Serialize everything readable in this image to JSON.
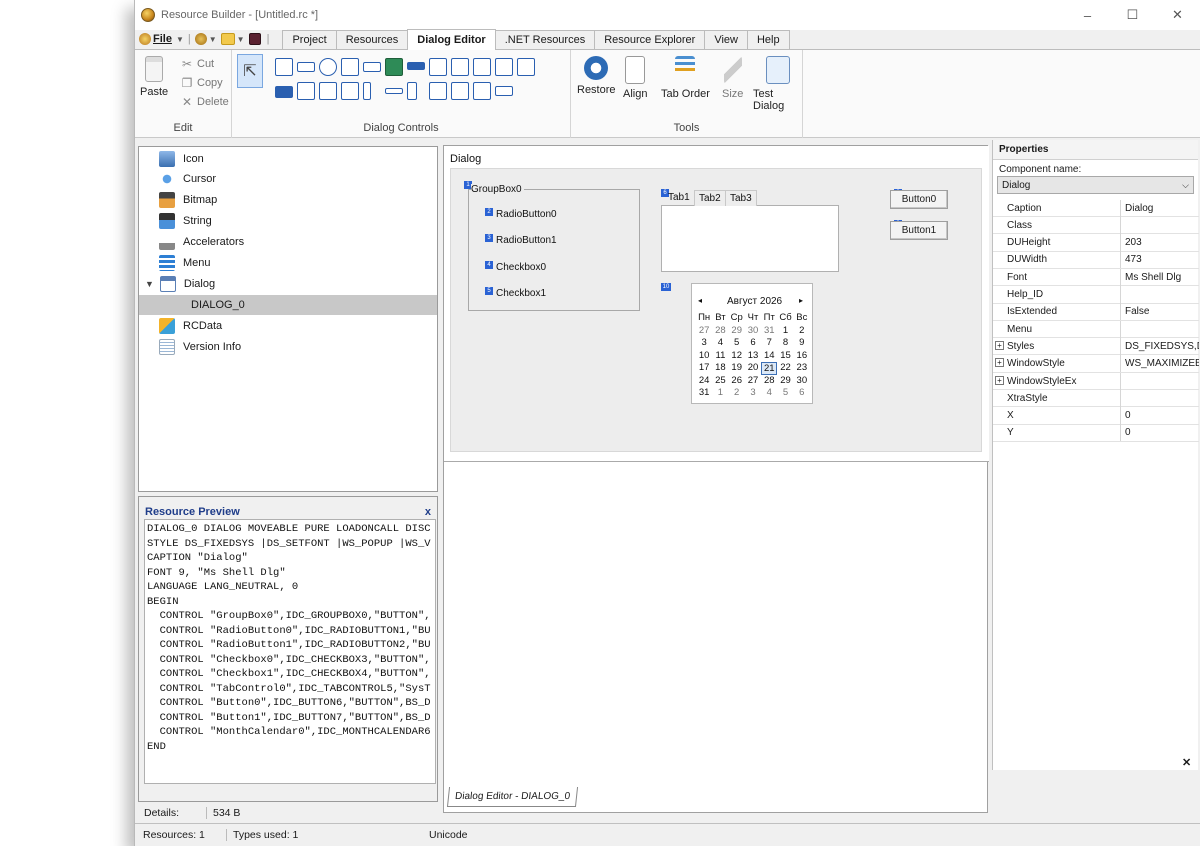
{
  "window": {
    "title": "Resource Builder - [Untitled.rc *]",
    "minimize": "–",
    "maximize": "☐",
    "close": "✕"
  },
  "quick_access": {
    "file_label": "File"
  },
  "menu_tabs": [
    "Project",
    "Resources",
    "Dialog Editor",
    ".NET Resources",
    "Resource Explorer",
    "View",
    "Help"
  ],
  "active_menu_tab": "Dialog Editor",
  "ribbon": {
    "edit_group": {
      "paste": "Paste",
      "cut": "Cut",
      "copy": "Copy",
      "delete": "Delete",
      "label": "Edit"
    },
    "controls_group": {
      "label": "Dialog Controls"
    },
    "tools_group": {
      "restore": "Restore",
      "align": "Align",
      "tab_order": "Tab Order",
      "size": "Size",
      "test_dialog": "Test Dialog",
      "label": "Tools"
    }
  },
  "tree": {
    "items": [
      "Icon",
      "Cursor",
      "Bitmap",
      "String",
      "Accelerators",
      "Menu",
      "Dialog",
      "DIALOG_0",
      "RCData",
      "Version Info"
    ],
    "selected": "DIALOG_0"
  },
  "preview": {
    "title": "Resource Preview",
    "close": "x",
    "lines": [
      "DIALOG_0 DIALOG MOVEABLE PURE LOADONCALL DISC",
      "STYLE DS_FIXEDSYS |DS_SETFONT |WS_POPUP |WS_V",
      "CAPTION \"Dialog\"",
      "FONT 9, \"Ms Shell Dlg\"",
      "LANGUAGE LANG_NEUTRAL, 0",
      "BEGIN",
      "  CONTROL \"GroupBox0\",IDC_GROUPBOX0,\"BUTTON\",",
      "  CONTROL \"RadioButton0\",IDC_RADIOBUTTON1,\"BU",
      "  CONTROL \"RadioButton1\",IDC_RADIOBUTTON2,\"BU",
      "  CONTROL \"Checkbox0\",IDC_CHECKBOX3,\"BUTTON\",",
      "  CONTROL \"Checkbox1\",IDC_CHECKBOX4,\"BUTTON\",",
      "  CONTROL \"TabControl0\",IDC_TABCONTROL5,\"SysT",
      "  CONTROL \"Button0\",IDC_BUTTON6,\"BUTTON\",BS_D",
      "  CONTROL \"Button1\",IDC_BUTTON7,\"BUTTON\",BS_D",
      "  CONTROL \"MonthCalendar0\",IDC_MONTHCALENDAR6",
      "END"
    ]
  },
  "details": {
    "label": "Details:",
    "value": "534 B"
  },
  "status": {
    "resources": "Resources: 1",
    "types_used": "Types used: 1",
    "encoding": "Unicode"
  },
  "editor": {
    "dialog_caption": "Dialog",
    "doc_tab": "Dialog Editor - DIALOG_0",
    "controls": {
      "groupbox": {
        "label": "GroupBox0",
        "id": "1"
      },
      "radio0": {
        "label": "RadioButton0",
        "id": "2"
      },
      "radio1": {
        "label": "RadioButton1",
        "id": "3"
      },
      "check0": {
        "label": "Checkbox0",
        "id": "4"
      },
      "check1": {
        "label": "Checkbox1",
        "id": "5"
      },
      "tabctl": {
        "id": "6",
        "tabs": [
          "Tab1",
          "Tab2",
          "Tab3"
        ]
      },
      "button0": {
        "label": "Button0",
        "id": "8"
      },
      "button1": {
        "label": "Button1",
        "id": "9"
      },
      "calendar": {
        "id": "10",
        "month": "Август 2026",
        "prev": "◂",
        "next": "▸",
        "weekdays": [
          "Пн",
          "Вт",
          "Ср",
          "Чт",
          "Пт",
          "Сб",
          "Вс"
        ],
        "weeks": [
          [
            "27",
            "28",
            "29",
            "30",
            "31",
            "1",
            "2"
          ],
          [
            "3",
            "4",
            "5",
            "6",
            "7",
            "8",
            "9"
          ],
          [
            "10",
            "11",
            "12",
            "13",
            "14",
            "15",
            "16"
          ],
          [
            "17",
            "18",
            "19",
            "20",
            "21",
            "22",
            "23"
          ],
          [
            "24",
            "25",
            "26",
            "27",
            "28",
            "29",
            "30"
          ],
          [
            "31",
            "1",
            "2",
            "3",
            "4",
            "5",
            "6"
          ]
        ],
        "today": "21"
      }
    }
  },
  "properties": {
    "header": "Properties",
    "component_label": "Component name:",
    "component_value": "Dialog",
    "rows": [
      {
        "name": "Caption",
        "value": "Dialog",
        "expandable": false
      },
      {
        "name": "Class",
        "value": "",
        "expandable": false
      },
      {
        "name": "DUHeight",
        "value": "203",
        "expandable": false
      },
      {
        "name": "DUWidth",
        "value": "473",
        "expandable": false
      },
      {
        "name": "Font",
        "value": "Ms Shell Dlg",
        "expandable": false
      },
      {
        "name": "Help_ID",
        "value": "",
        "expandable": false
      },
      {
        "name": "IsExtended",
        "value": "False",
        "expandable": false
      },
      {
        "name": "Menu",
        "value": "",
        "expandable": false
      },
      {
        "name": "Styles",
        "value": "DS_FIXEDSYS,DS_S",
        "expandable": true
      },
      {
        "name": "WindowStyle",
        "value": "WS_MAXIMIZEBOX",
        "expandable": true
      },
      {
        "name": "WindowStyleEx",
        "value": "",
        "expandable": true
      },
      {
        "name": "XtraStyle",
        "value": "",
        "expandable": false
      },
      {
        "name": "X",
        "value": "0",
        "expandable": false
      },
      {
        "name": "Y",
        "value": "0",
        "expandable": false
      }
    ],
    "close": "✕"
  },
  "colors": {
    "accent": "#2a62d4",
    "selection": "#c8c8c8",
    "preview_title": "#1f3d8a"
  }
}
